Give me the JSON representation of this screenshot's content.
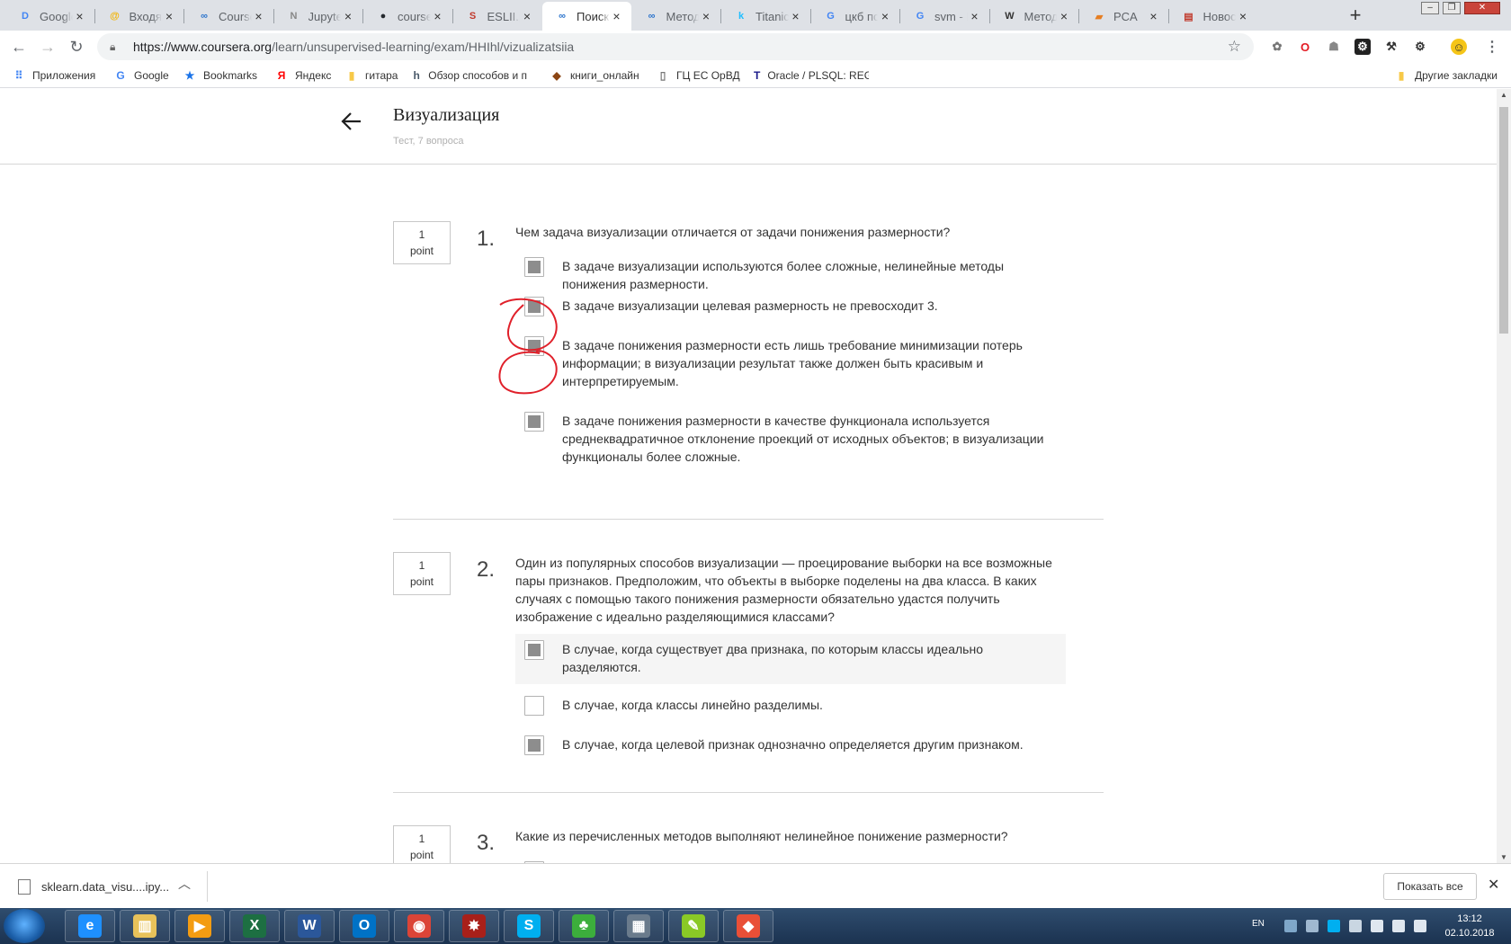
{
  "browser": {
    "tabs": [
      {
        "title": "Google",
        "icon": "google-drive-icon",
        "color": "#4285f4",
        "glyph": "D"
      },
      {
        "title": "Входящие",
        "icon": "mail-icon",
        "color": "#f4b400",
        "glyph": "@"
      },
      {
        "title": "Coursera",
        "icon": "coursera-icon",
        "color": "#2a73cc",
        "glyph": "∞"
      },
      {
        "title": "Jupyter",
        "icon": "jupyter-icon",
        "color": "#888888",
        "glyph": "N"
      },
      {
        "title": "coursera",
        "icon": "github-icon",
        "color": "#24292e",
        "glyph": "●"
      },
      {
        "title": "ESLII.pdf",
        "icon": "pdf-icon",
        "color": "#c0392b",
        "glyph": "S"
      },
      {
        "title": "Поиск по",
        "icon": "coursera-icon",
        "color": "#2a73cc",
        "glyph": "∞",
        "active": true
      },
      {
        "title": "Метод главных",
        "icon": "coursera-icon",
        "color": "#2a73cc",
        "glyph": "∞"
      },
      {
        "title": "Titanic",
        "icon": "kaggle-icon",
        "color": "#20beff",
        "glyph": "k"
      },
      {
        "title": "цкб пол",
        "icon": "google-icon",
        "color": "#4285f4",
        "glyph": "G"
      },
      {
        "title": "svm - П",
        "icon": "google-icon",
        "color": "#4285f4",
        "glyph": "G"
      },
      {
        "title": "Метод",
        "icon": "wikipedia-icon",
        "color": "#333333",
        "glyph": "W"
      },
      {
        "title": "PCA",
        "icon": "book-icon",
        "color": "#e67e22",
        "glyph": "▰"
      },
      {
        "title": "Новост",
        "icon": "news-icon",
        "color": "#c0392b",
        "glyph": "▤"
      }
    ],
    "new_tab_label": "+",
    "url_main": "https://www.coursera.org",
    "url_path": "/learn/unsupervised-learning/exam/HHIhl/vizualizatsiia",
    "bookmarks": [
      {
        "label": "Приложения",
        "icon": "apps-grid-icon",
        "color": "#4285f4",
        "glyph": "⠿"
      },
      {
        "label": "Google",
        "icon": "google-icon",
        "color": "#4285f4",
        "glyph": "G"
      },
      {
        "label": "Bookmarks",
        "icon": "star-icon",
        "color": "#1a73e8",
        "glyph": "★"
      },
      {
        "label": "Яндекс",
        "icon": "yandex-icon",
        "color": "#ff0000",
        "glyph": "Я"
      },
      {
        "label": "гитара",
        "icon": "folder-icon",
        "color": "#f7c948",
        "glyph": "▮"
      },
      {
        "label": "Обзор способов и п",
        "icon": "habr-icon",
        "color": "#4a5a6a",
        "glyph": "h"
      },
      {
        "label": "книги_онлайн",
        "icon": "book-icon",
        "color": "#8b4513",
        "glyph": "◆"
      },
      {
        "label": "ГЦ ЕС ОрВД",
        "icon": "page-icon",
        "color": "#777777",
        "glyph": "▯"
      },
      {
        "label": "Oracle / PLSQL: REGE",
        "icon": "oracle-icon",
        "color": "#1a1a8a",
        "glyph": "T"
      }
    ],
    "other_bookmarks": "Другие закладки"
  },
  "quiz": {
    "title": "Визуализация",
    "subtitle": "Тест, 7 вопроса",
    "questions": [
      {
        "points": "1",
        "points_unit": "point",
        "number": "1.",
        "text": "Чем задача визуализации отличается от задачи понижения размерности?",
        "options": [
          {
            "text": "В задаче визуализации используются более сложные, нелинейные методы понижения размерности.",
            "checked": true
          },
          {
            "text": "В задаче визуализации целевая размерность не превосходит 3.",
            "checked": true
          },
          {
            "text": "В задаче понижения размерности есть лишь требование минимизации потерь информации; в визуализации результат также должен быть красивым и интерпретируемым.",
            "checked": true
          },
          {
            "text": "В задаче понижения размерности в качестве функционала используется среднеквадратичное отклонение проекций от исходных объектов; в визуализации функционалы более сложные.",
            "checked": true
          }
        ]
      },
      {
        "points": "1",
        "points_unit": "point",
        "number": "2.",
        "text": "Один из популярных способов визуализации — проецирование выборки на все возможные пары признаков. Предположим, что объекты в выборке поделены на два класса. В каких случаях с помощью такого понижения размерности обязательно удастся получить изображение с идеально разделяющимися классами?",
        "options": [
          {
            "text": "В случае, когда существует два признака, по которым классы идеально разделяются.",
            "checked": true,
            "highlighted": true
          },
          {
            "text": "В случае, когда классы линейно разделимы.",
            "checked": false
          },
          {
            "text": "В случае, когда целевой признак однозначно определяется другим признаком.",
            "checked": true
          }
        ]
      },
      {
        "points": "1",
        "points_unit": "point",
        "number": "3.",
        "text": "Какие из перечисленных методов выполняют нелинейное понижение размерности?"
      }
    ]
  },
  "downloads": {
    "file_name": "sklearn.data_visu....ipy...",
    "show_all": "Показать все"
  },
  "taskbar": {
    "apps": [
      {
        "icon": "internet-explorer-icon",
        "color": "#1e90ff",
        "glyph": "e"
      },
      {
        "icon": "file-explorer-icon",
        "color": "#e8c25a",
        "glyph": "▥"
      },
      {
        "icon": "media-player-icon",
        "color": "#f39c12",
        "glyph": "▶"
      },
      {
        "icon": "excel-icon",
        "color": "#1d6f42",
        "glyph": "X"
      },
      {
        "icon": "word-icon",
        "color": "#2b579a",
        "glyph": "W"
      },
      {
        "icon": "outlook-icon",
        "color": "#0072c6",
        "glyph": "O"
      },
      {
        "icon": "chrome-icon",
        "color": "#db4437",
        "glyph": "◉"
      },
      {
        "icon": "ruby-icon",
        "color": "#a8201a",
        "glyph": "✸"
      },
      {
        "icon": "skype-icon",
        "color": "#00aff0",
        "glyph": "S"
      },
      {
        "icon": "solitaire-icon",
        "color": "#3cae3c",
        "glyph": "♣"
      },
      {
        "icon": "window-app-icon",
        "color": "#6a7b8c",
        "glyph": "▦"
      },
      {
        "icon": "chart-app-icon",
        "color": "#8ac926",
        "glyph": "✎"
      },
      {
        "icon": "git-icon",
        "color": "#e94f37",
        "glyph": "◆"
      }
    ],
    "language": "EN",
    "time": "13:12",
    "date": "02.10.2018"
  }
}
